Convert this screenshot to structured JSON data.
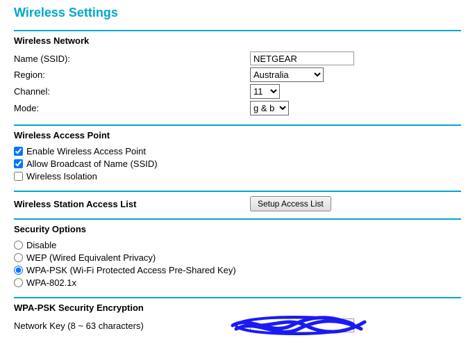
{
  "title": "Wireless Settings",
  "network": {
    "heading": "Wireless Network",
    "ssid_label": "Name (SSID):",
    "ssid_value": "NETGEAR",
    "region_label": "Region:",
    "region_value": "Australia",
    "channel_label": "Channel:",
    "channel_value": "11",
    "mode_label": "Mode:",
    "mode_value": "g & b"
  },
  "ap": {
    "heading": "Wireless Access Point",
    "enable_label": "Enable Wireless Access Point",
    "broadcast_label": "Allow Broadcast of Name (SSID)",
    "isolation_label": "Wireless Isolation"
  },
  "access_list": {
    "heading": "Wireless Station Access List",
    "button_label": "Setup Access List"
  },
  "security": {
    "heading": "Security Options",
    "opt_disable": "Disable",
    "opt_wep": "WEP (Wired Equivalent Privacy)",
    "opt_wpapsk": "WPA-PSK (Wi-Fi Protected Access Pre-Shared Key)",
    "opt_wpa8021x": "WPA-802.1x"
  },
  "wpapsk": {
    "heading": "WPA-PSK Security Encryption",
    "netkey_label": "Network Key (8 ~ 63 characters)"
  }
}
